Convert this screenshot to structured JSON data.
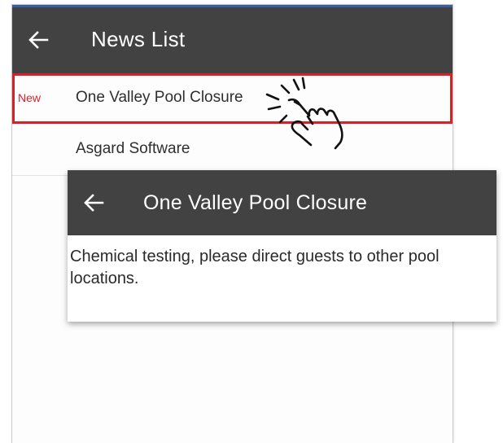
{
  "list_screen": {
    "title": "News List",
    "items": [
      {
        "badge": "New",
        "label": "One Valley Pool Closure",
        "selected": true
      },
      {
        "badge": "",
        "label": "Asgard Software",
        "selected": false
      }
    ]
  },
  "detail_screen": {
    "title": "One Valley Pool Closure",
    "body": "Chemical testing, please direct guests to other pool locations."
  },
  "icons": {
    "back": "arrow-left-icon",
    "pointer": "tap-hand-icon"
  },
  "colors": {
    "appbar": "#424242",
    "highlight": "#d4222b",
    "accent": "#3b5f9e"
  }
}
